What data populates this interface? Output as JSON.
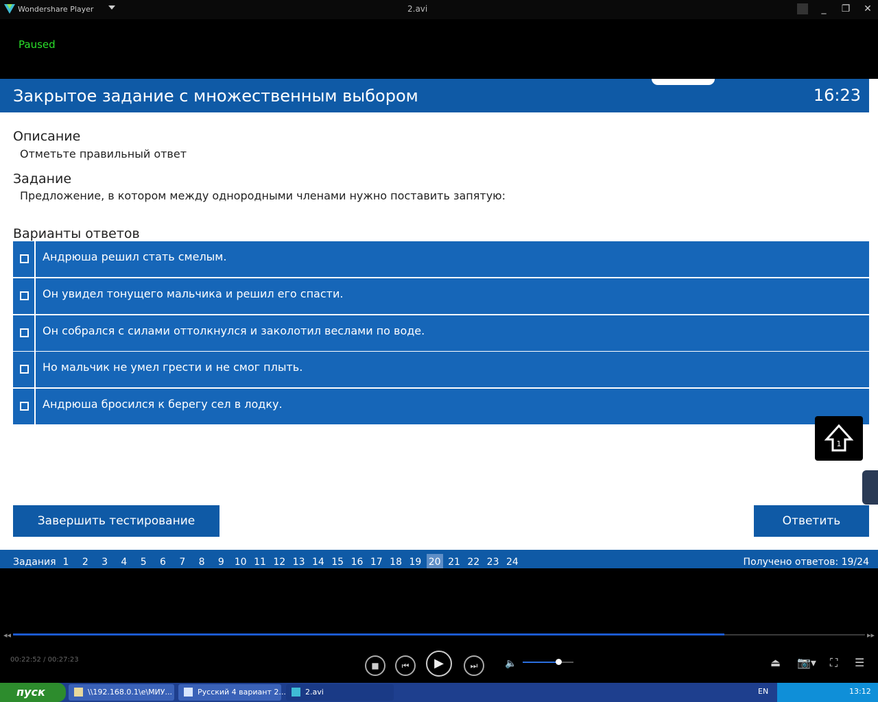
{
  "player": {
    "app_name": "Wondershare Player",
    "file_title": "2.avi",
    "status": "Paused",
    "time_readout": "00:22:52 / 00:27:23",
    "seek_progress": 0.835,
    "volume_level": 0.7
  },
  "quiz": {
    "header_title": "Закрытое задание с множественным выбором",
    "timer": "16:23",
    "description_heading": "Описание",
    "description_text": "Отметьте правильный ответ",
    "task_heading": "Задание",
    "task_text": "Предложение, в котором между однородными членами нужно поставить запятую:",
    "options_heading": "Варианты ответов",
    "options": [
      {
        "text": "Андрюша решил стать смелым.",
        "checked": false
      },
      {
        "text": "Он увидел тонущего мальчика и решил его спасти.",
        "checked": false
      },
      {
        "text": "Он собрался с силами оттолкнулся и заколотил веслами по воде.",
        "checked": false
      },
      {
        "text": "Но мальчик не умел грести и не смог плыть.",
        "checked": false
      },
      {
        "text": "Андрюша бросился к берегу сел в лодку.",
        "checked": false
      }
    ],
    "finish_button": "Завершить тестирование",
    "answer_button": "Ответить",
    "nav_label": "Задания",
    "nav_numbers": [
      "1",
      "2",
      "3",
      "4",
      "5",
      "6",
      "7",
      "8",
      "9",
      "10",
      "11",
      "12",
      "13",
      "14",
      "15",
      "16",
      "17",
      "18",
      "19",
      "20",
      "21",
      "22",
      "23",
      "24"
    ],
    "nav_active": "20",
    "answers_received": "Получено ответов: 19/24"
  },
  "taskbar": {
    "start_label": "пуск",
    "items": [
      {
        "label": "\\\\192.168.0.1\\e\\МИУ..."
      },
      {
        "label": "Русский 4 вариант 2..."
      },
      {
        "label": "2.avi"
      }
    ],
    "lang": "EN",
    "clock": "13:12"
  },
  "colors": {
    "accent": "#0f5aa6",
    "option_bg": "#1666b8",
    "status_green": "#2ae02a"
  },
  "icons": {
    "app_logo": "wondershare-logo-icon",
    "stop": "stop-icon",
    "prev": "previous-icon",
    "play": "play-icon",
    "next": "next-icon",
    "volume": "volume-icon",
    "eject": "eject-icon",
    "screenshot": "camera-icon",
    "fullscreen": "fullscreen-icon",
    "playlist": "playlist-icon"
  }
}
